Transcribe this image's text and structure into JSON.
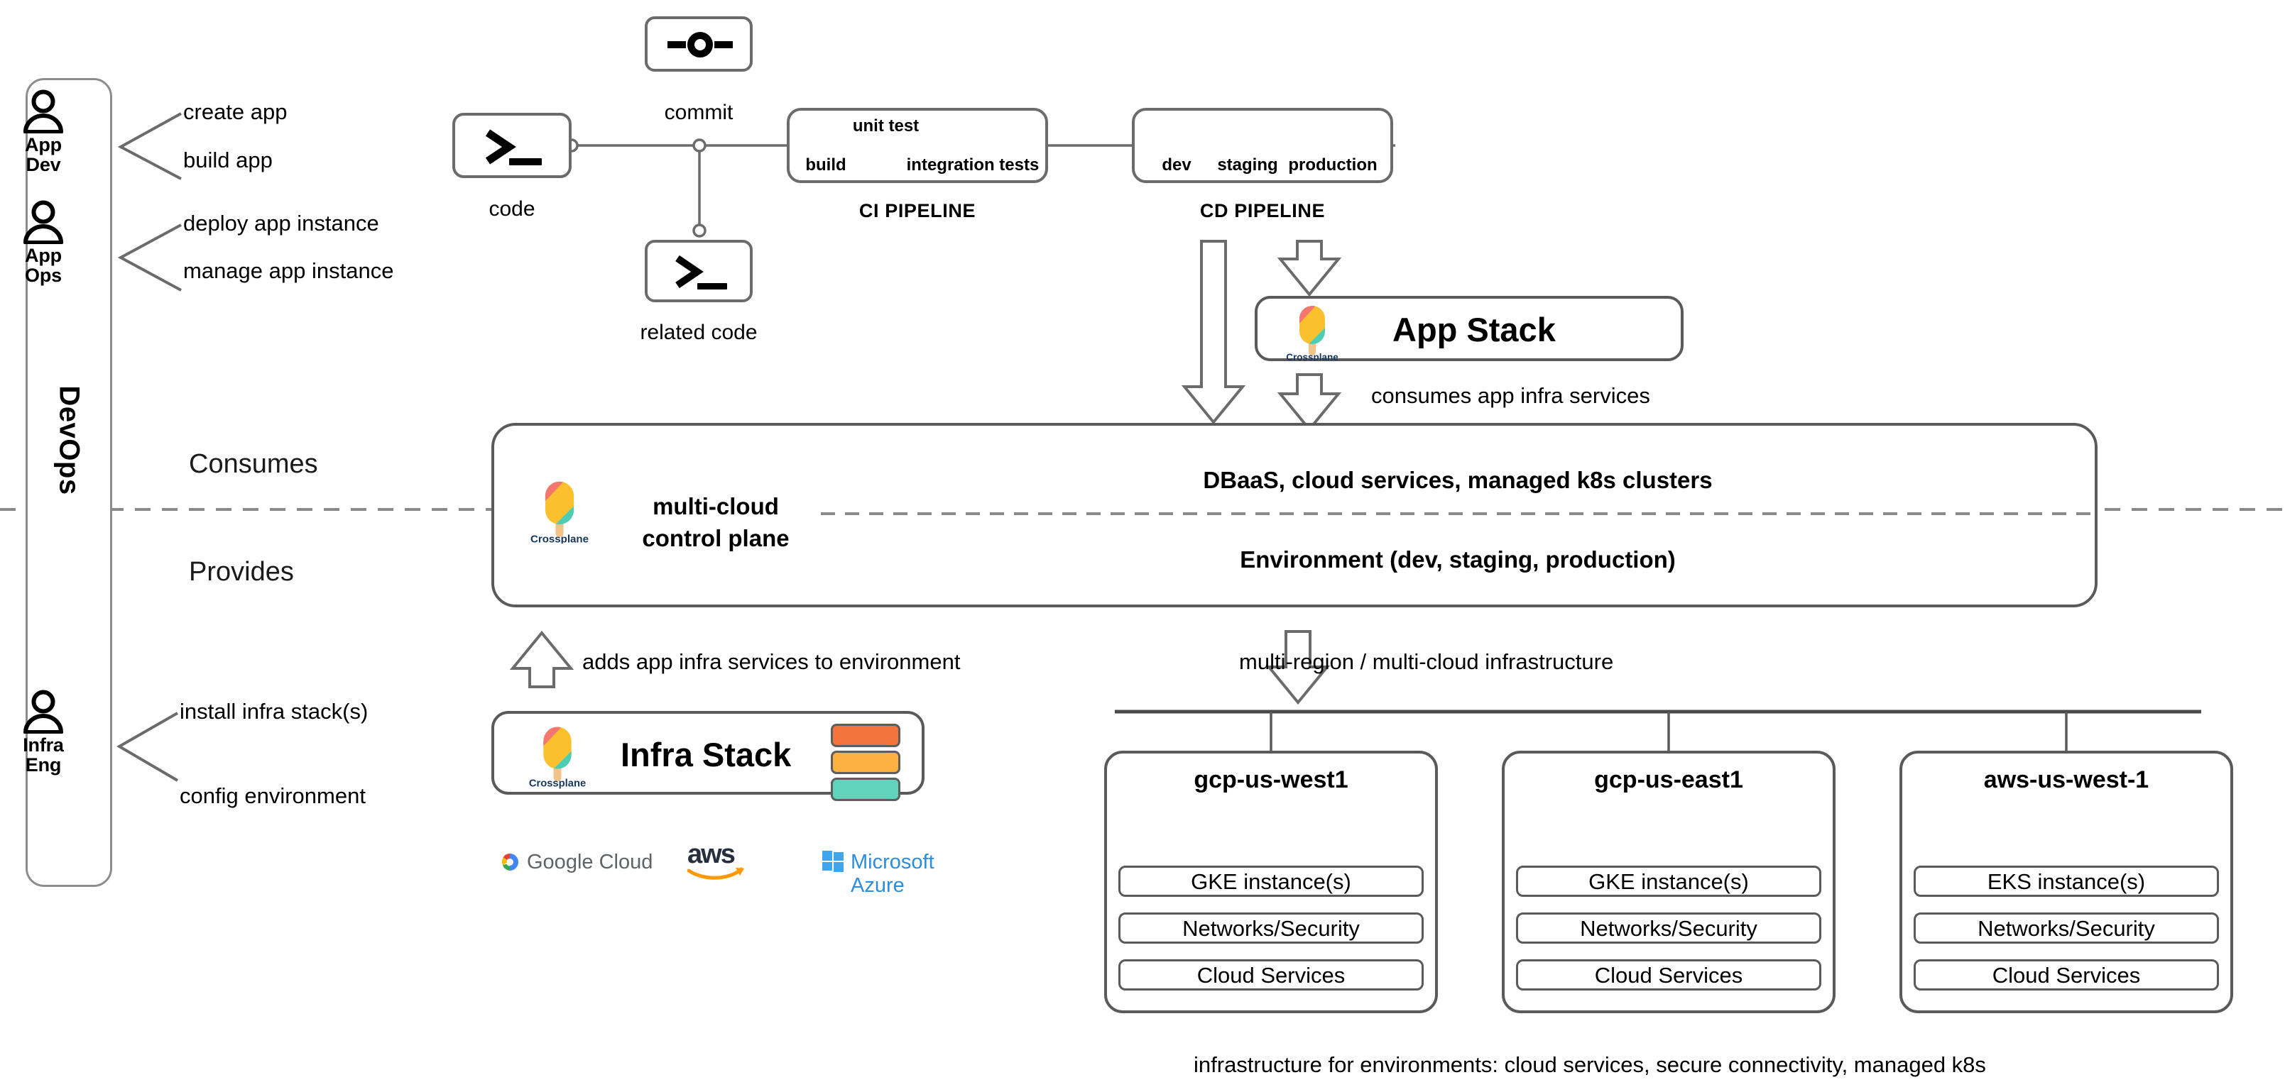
{
  "personas": [
    {
      "id": "app-dev",
      "line1": "App",
      "line2": "Dev",
      "tasks": [
        "create app",
        "build app"
      ]
    },
    {
      "id": "app-ops",
      "line1": "App",
      "line2": "Ops",
      "tasks": [
        "deploy app instance",
        "manage app instance"
      ]
    },
    {
      "id": "infra-eng",
      "line1": "Infra",
      "line2": "Eng",
      "tasks": [
        "install infra stack(s)",
        "config environment"
      ]
    }
  ],
  "devops_label": "DevOps",
  "nodes": {
    "code_caption": "code",
    "commit_caption": "commit",
    "related_code_caption": "related code",
    "terminal_glyph": ">_",
    "commit_glyph": "–o–"
  },
  "ci_pipeline": {
    "title": "CI PIPELINE",
    "above_labels": [
      "unit test"
    ],
    "below_labels": [
      "build",
      "integration tests"
    ]
  },
  "cd_pipeline": {
    "title": "CD PIPELINE",
    "stages": [
      "dev",
      "staging",
      "production"
    ]
  },
  "app_stack": {
    "title": "App Stack",
    "logo_word": "Crossplane",
    "arrow_label": "consumes app infra services"
  },
  "control_plane": {
    "left_line1": "multi-cloud",
    "left_line2": "control plane",
    "logo_word": "Crossplane",
    "top_text": "DBaaS, cloud services, managed k8s clusters",
    "bottom_text": "Environment (dev, staging, production)",
    "side_top": "Consumes",
    "side_bottom": "Provides"
  },
  "infra_stack": {
    "title": "Infra Stack",
    "logo_word": "Crossplane",
    "arrow_label": "adds app infra services to environment",
    "bars": [
      {
        "name": "bar-orange",
        "color": "#F4743B"
      },
      {
        "name": "bar-amber",
        "color": "#FBB040"
      },
      {
        "name": "bar-teal",
        "color": "#5FD3BC"
      }
    ],
    "clouds": [
      {
        "id": "google-cloud",
        "label": "Google Cloud"
      },
      {
        "id": "aws",
        "label": "aws"
      },
      {
        "id": "azure",
        "label": "Microsoft Azure"
      }
    ]
  },
  "infrastructure": {
    "arrow_label": "multi-region / multi-cloud infrastructure",
    "caption": "infrastructure for environments: cloud services, secure connectivity, managed k8s",
    "regions": [
      {
        "name": "gcp-us-west1",
        "items": [
          "GKE instance(s)",
          "Networks/Security",
          "Cloud Services"
        ]
      },
      {
        "name": "gcp-us-east1",
        "items": [
          "GKE instance(s)",
          "Networks/Security",
          "Cloud Services"
        ]
      },
      {
        "name": "aws-us-west-1",
        "items": [
          "EKS instance(s)",
          "Networks/Security",
          "Cloud Services"
        ]
      }
    ]
  },
  "colors": {
    "crossplane_coral": "#F4766E",
    "crossplane_yellow": "#FBC02D",
    "crossplane_teal": "#4ECDB6",
    "crossplane_stick": "#F2C48A",
    "crossplane_text": "#17375e",
    "stroke": "#5a5a5a",
    "dashed": "#7a7a7a"
  }
}
